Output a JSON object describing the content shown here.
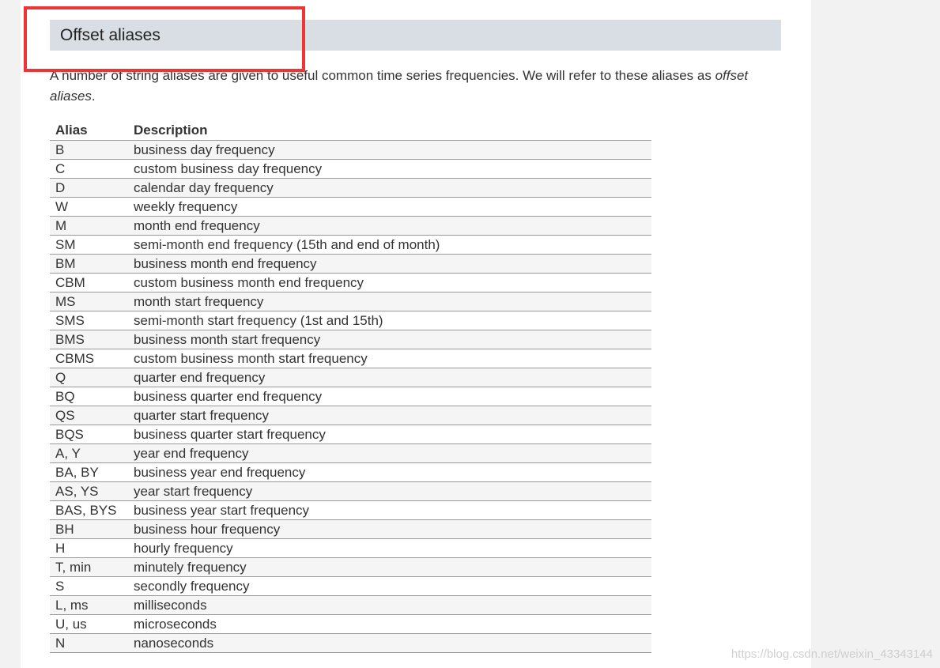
{
  "section": {
    "title": "Offset aliases"
  },
  "intro": {
    "text_before": "A number of string aliases are given to useful common time series frequencies. We will refer to these aliases as ",
    "emphasis": "offset aliases",
    "text_after": "."
  },
  "table": {
    "headers": {
      "alias": "Alias",
      "description": "Description"
    },
    "rows": [
      {
        "alias": "B",
        "description": "business day frequency"
      },
      {
        "alias": "C",
        "description": "custom business day frequency"
      },
      {
        "alias": "D",
        "description": "calendar day frequency"
      },
      {
        "alias": "W",
        "description": "weekly frequency"
      },
      {
        "alias": "M",
        "description": "month end frequency"
      },
      {
        "alias": "SM",
        "description": "semi-month end frequency (15th and end of month)"
      },
      {
        "alias": "BM",
        "description": "business month end frequency"
      },
      {
        "alias": "CBM",
        "description": "custom business month end frequency"
      },
      {
        "alias": "MS",
        "description": "month start frequency"
      },
      {
        "alias": "SMS",
        "description": "semi-month start frequency (1st and 15th)"
      },
      {
        "alias": "BMS",
        "description": "business month start frequency"
      },
      {
        "alias": "CBMS",
        "description": "custom business month start frequency"
      },
      {
        "alias": "Q",
        "description": "quarter end frequency"
      },
      {
        "alias": "BQ",
        "description": "business quarter end frequency"
      },
      {
        "alias": "QS",
        "description": "quarter start frequency"
      },
      {
        "alias": "BQS",
        "description": "business quarter start frequency"
      },
      {
        "alias": "A, Y",
        "description": "year end frequency"
      },
      {
        "alias": "BA, BY",
        "description": "business year end frequency"
      },
      {
        "alias": "AS, YS",
        "description": "year start frequency"
      },
      {
        "alias": "BAS, BYS",
        "description": "business year start frequency"
      },
      {
        "alias": "BH",
        "description": "business hour frequency"
      },
      {
        "alias": "H",
        "description": "hourly frequency"
      },
      {
        "alias": "T, min",
        "description": "minutely frequency"
      },
      {
        "alias": "S",
        "description": "secondly frequency"
      },
      {
        "alias": "L, ms",
        "description": "milliseconds"
      },
      {
        "alias": "U, us",
        "description": "microseconds"
      },
      {
        "alias": "N",
        "description": "nanoseconds"
      }
    ]
  },
  "watermark": "https://blog.csdn.net/weixin_43343144",
  "colors": {
    "header_band": "#d9dde4",
    "highlight_border": "#ee3535",
    "row_stripe": "#f5f5f5",
    "text": "#333333"
  }
}
